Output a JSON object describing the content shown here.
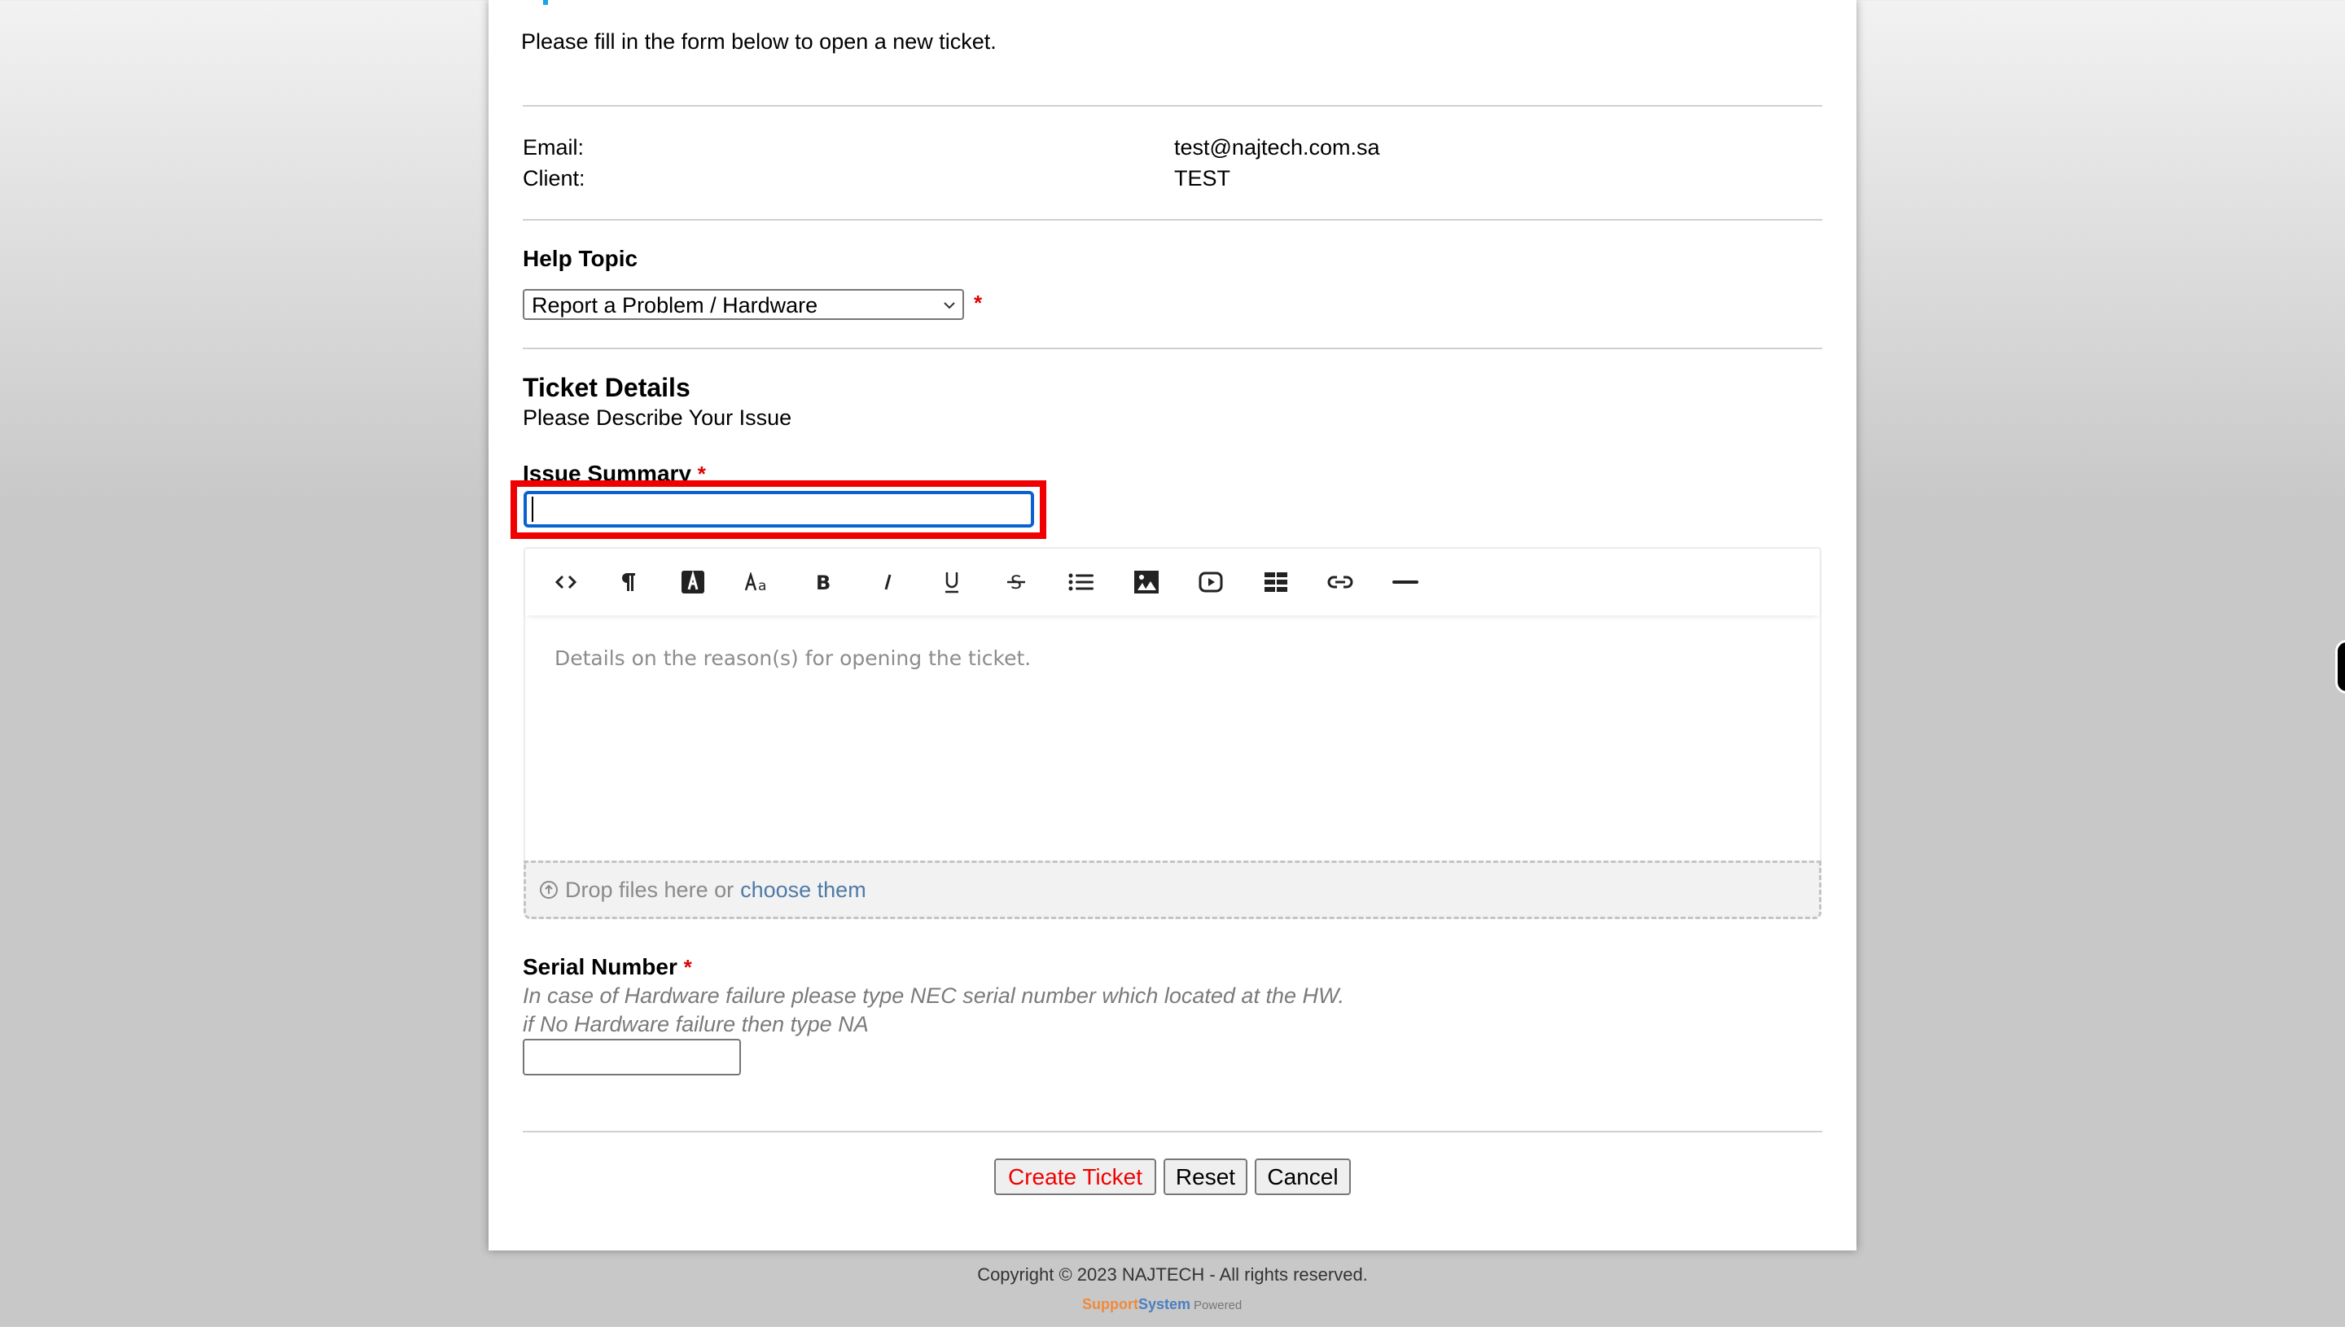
{
  "page": {
    "intro": "Please fill in the form below to open a new ticket."
  },
  "user_info": {
    "email_label": "Email:",
    "email_value": "test@najtech.com.sa",
    "client_label": "Client:",
    "client_value": "TEST"
  },
  "help_topic": {
    "label": "Help Topic",
    "selected": "Report a Problem / Hardware",
    "required_mark": "*"
  },
  "ticket_details": {
    "title": "Ticket Details",
    "subtitle": "Please Describe Your Issue",
    "issue_summary_label": "Issue Summary",
    "issue_summary_required": "*",
    "issue_summary_value": "",
    "editor": {
      "toolbar": [
        {
          "icon": "code-view-icon",
          "title": "HTML"
        },
        {
          "icon": "paragraph-icon",
          "title": "Paragraph"
        },
        {
          "icon": "font-color-icon",
          "title": "Text Color"
        },
        {
          "icon": "font-size-icon",
          "title": "Font Size"
        },
        {
          "icon": "bold-icon",
          "title": "Bold"
        },
        {
          "icon": "italic-icon",
          "title": "Italic"
        },
        {
          "icon": "underline-icon",
          "title": "Underline"
        },
        {
          "icon": "strikethrough-icon",
          "title": "Strikethrough"
        },
        {
          "icon": "list-icon",
          "title": "List"
        },
        {
          "icon": "image-icon",
          "title": "Image"
        },
        {
          "icon": "video-icon",
          "title": "Video"
        },
        {
          "icon": "table-icon",
          "title": "Table"
        },
        {
          "icon": "link-icon",
          "title": "Link"
        },
        {
          "icon": "horizontal-rule-icon",
          "title": "Horizontal Rule"
        }
      ],
      "placeholder": "Details on the reason(s) for opening the ticket."
    },
    "dropzone": {
      "text": "Drop files here or",
      "link": "choose them"
    }
  },
  "serial_number": {
    "label": "Serial Number",
    "required_mark": "*",
    "help_line1": "In case of Hardware failure please type NEC serial number which located at the HW.",
    "help_line2": "if No Hardware failure then type NA",
    "value": ""
  },
  "actions": {
    "create": "Create Ticket",
    "reset": "Reset",
    "cancel": "Cancel"
  },
  "footer": {
    "copyright": "Copyright © 2023 NAJTECH - All rights reserved.",
    "powered_support": "Support",
    "powered_system": "System",
    "powered_word": "Powered"
  },
  "colors": {
    "required": "#e00000",
    "focus_ring": "#0a62d0",
    "highlight_box": "#f00000",
    "link": "#4f7aa6",
    "create_button_text": "#f00000"
  }
}
